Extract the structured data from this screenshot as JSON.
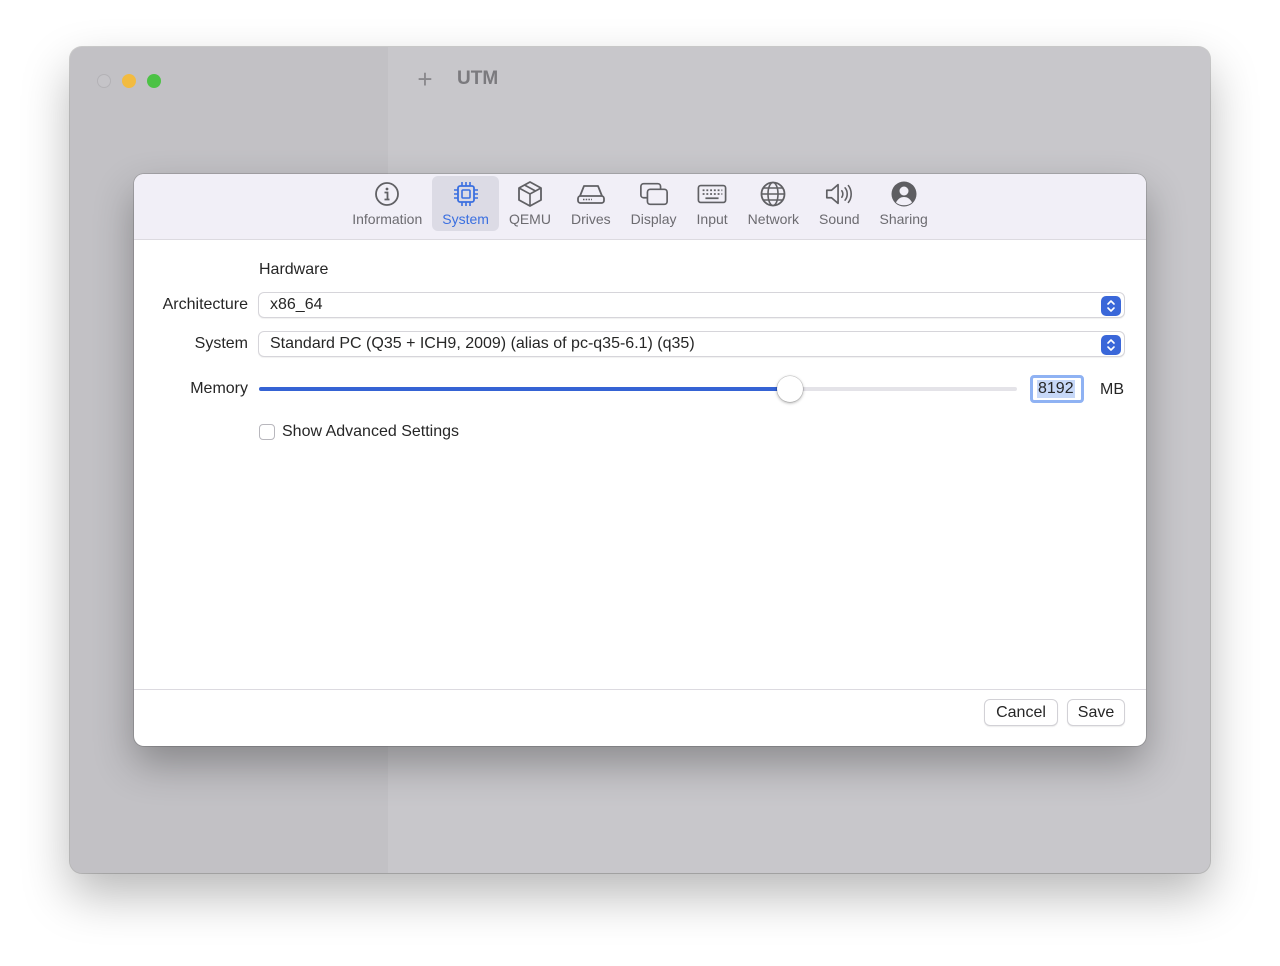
{
  "window": {
    "title": "UTM",
    "add_icon": "plus-icon"
  },
  "tabs": [
    {
      "label": "Information",
      "icon": "info-icon",
      "active": false
    },
    {
      "label": "System",
      "icon": "cpu-icon",
      "active": true
    },
    {
      "label": "QEMU",
      "icon": "cube-icon",
      "active": false
    },
    {
      "label": "Drives",
      "icon": "drive-icon",
      "active": false
    },
    {
      "label": "Display",
      "icon": "display-icon",
      "active": false
    },
    {
      "label": "Input",
      "icon": "keyboard-icon",
      "active": false
    },
    {
      "label": "Network",
      "icon": "globe-icon",
      "active": false
    },
    {
      "label": "Sound",
      "icon": "speaker-icon",
      "active": false
    },
    {
      "label": "Sharing",
      "icon": "person-icon",
      "active": false
    }
  ],
  "system": {
    "section_title": "Hardware",
    "architecture": {
      "label": "Architecture",
      "value": "x86_64"
    },
    "system": {
      "label": "System",
      "value": "Standard PC (Q35 + ICH9, 2009) (alias of pc-q35-6.1) (q35)"
    },
    "memory": {
      "label": "Memory",
      "value": "8192",
      "unit": "MB",
      "slider_fraction": 0.7
    },
    "advanced": {
      "label": "Show Advanced Settings",
      "checked": false
    }
  },
  "footer": {
    "cancel_label": "Cancel",
    "save_label": "Save"
  },
  "colors": {
    "accent": "#3a6fe0",
    "slider_fill": "#3563d4",
    "traffic_min": "#f2bb40",
    "traffic_max": "#4cc245"
  }
}
